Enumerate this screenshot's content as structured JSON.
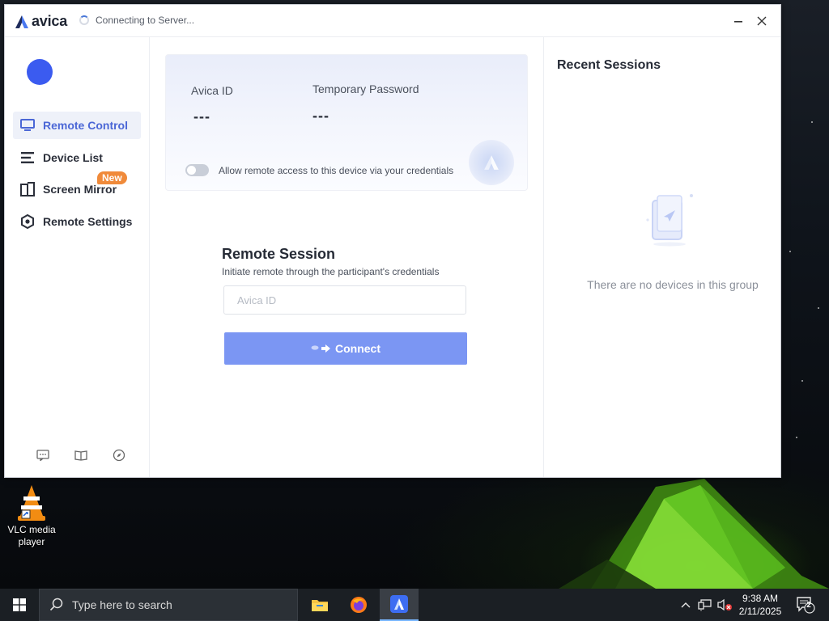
{
  "window": {
    "app_name": "avica",
    "status": "Connecting to Server..."
  },
  "sidebar": {
    "items": [
      {
        "label": "Remote Control",
        "icon": "monitor-icon",
        "active": true
      },
      {
        "label": "Device List",
        "icon": "list-icon"
      },
      {
        "label": "Screen Mirror",
        "icon": "screen-mirror-icon"
      },
      {
        "label": "Remote Settings",
        "icon": "settings-hexagon-icon"
      }
    ],
    "badge_new": "New",
    "footer_icons": [
      "feedback-icon",
      "guide-book-icon",
      "compass-icon"
    ]
  },
  "id_card": {
    "avica_id_label": "Avica ID",
    "avica_id_value": "---",
    "password_label": "Temporary Password",
    "password_value": "---",
    "allow_access_label": "Allow remote access to this device via your credentials"
  },
  "remote_session": {
    "title": "Remote Session",
    "subtitle": "Initiate remote through the participant's credentials",
    "input_placeholder": "Avica ID",
    "connect_label": "Connect"
  },
  "recent_sessions": {
    "title": "Recent Sessions",
    "empty_text": "There are no devices in this group"
  },
  "desktop": {
    "icons": [
      {
        "label": "VLC media player",
        "icon": "vlc-icon"
      }
    ]
  },
  "taskbar": {
    "search_placeholder": "Type here to search",
    "time": "9:38 AM",
    "date": "2/11/2025",
    "notification_count": "2",
    "apps": [
      "file-explorer-icon",
      "firefox-icon",
      "avica-icon"
    ]
  },
  "colors": {
    "accent": "#4b67d6",
    "connect_button": "#7b96f3",
    "avatar": "#3b5bf0",
    "badge_new": "#f08a3a"
  }
}
